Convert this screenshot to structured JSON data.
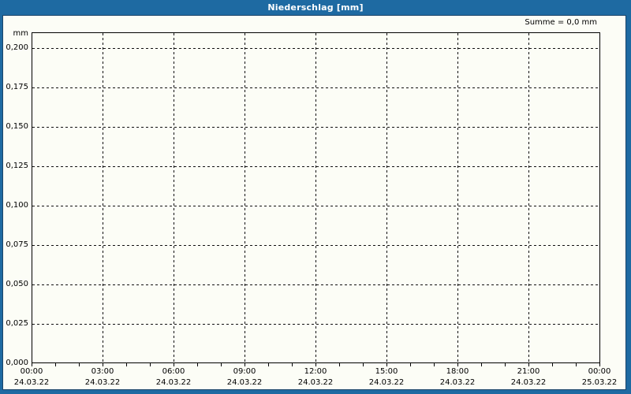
{
  "window": {
    "title": "Niederschlag [mm]",
    "frame_color": "#1e6aa2",
    "frame_edge_color": "#1a4468",
    "content_background": "#fcfdf6",
    "title_text_color": "#ffffff"
  },
  "chart_data": {
    "type": "bar",
    "title": "Niederschlag [mm]",
    "ylabel": "mm",
    "annotation": "Summe = 0,0 mm",
    "sum_mm": 0.0,
    "grid": "dashed",
    "legend": "none",
    "ylim": [
      0.0,
      0.21
    ],
    "y_ticks": [
      "0,200",
      "0,175",
      "0,150",
      "0,125",
      "0,100",
      "0,075",
      "0,050",
      "0,025",
      "0,000"
    ],
    "y_tick_values": [
      0.2,
      0.175,
      0.15,
      0.125,
      0.1,
      0.075,
      0.05,
      0.025,
      0.0
    ],
    "x_range": [
      "24.03.22 00:00",
      "25.03.22 00:00"
    ],
    "x_minor_tick_hours": 1,
    "x_ticks": [
      {
        "time": "00:00",
        "date": "24.03.22"
      },
      {
        "time": "03:00",
        "date": "24.03.22"
      },
      {
        "time": "06:00",
        "date": "24.03.22"
      },
      {
        "time": "09:00",
        "date": "24.03.22"
      },
      {
        "time": "12:00",
        "date": "24.03.22"
      },
      {
        "time": "15:00",
        "date": "24.03.22"
      },
      {
        "time": "18:00",
        "date": "24.03.22"
      },
      {
        "time": "21:00",
        "date": "24.03.22"
      },
      {
        "time": "00:00",
        "date": "25.03.22"
      }
    ],
    "series": [
      {
        "name": "Niederschlag",
        "values": []
      }
    ]
  }
}
